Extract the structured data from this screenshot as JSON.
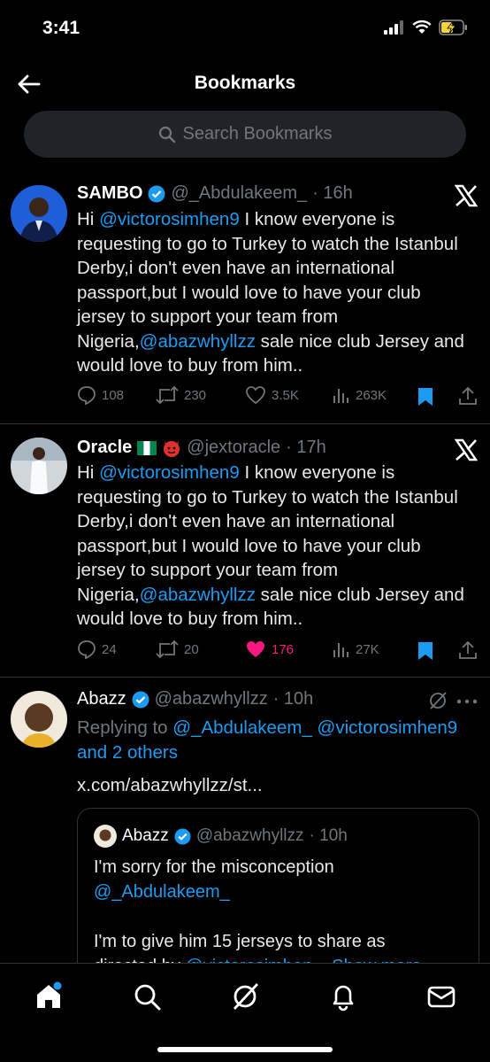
{
  "status": {
    "time": "3:41"
  },
  "header": {
    "title": "Bookmarks"
  },
  "search": {
    "placeholder": "Search Bookmarks"
  },
  "tweets": [
    {
      "name": "SAMBO",
      "handle": "@_Abdulakeem_",
      "time": "· 16h",
      "body": [
        {
          "t": "Hi ",
          "c": "text"
        },
        {
          "t": "@victorosimhen9",
          "c": "link"
        },
        {
          "t": " I know everyone is requesting to go to Turkey to watch the Istanbul Derby,i don't even have an international passport,but I would love to have your club jersey to support your team from Nigeria,",
          "c": "text"
        },
        {
          "t": "@abazwhyllzz",
          "c": "link"
        },
        {
          "t": " sale nice club Jersey and would love to buy from him..",
          "c": "text"
        }
      ],
      "replies": "108",
      "retweets": "230",
      "likes": "3.5K",
      "views": "263K"
    },
    {
      "name": "Oracle",
      "handle": "@jextoracle",
      "time": "· 17h",
      "body": [
        {
          "t": "Hi ",
          "c": "text"
        },
        {
          "t": "@victorosimhen9",
          "c": "link"
        },
        {
          "t": " I know everyone is requesting to go to Turkey to watch the Istanbul Derby,i don't even have an international passport,but I would love to have your club jersey to support your team from Nigeria,",
          "c": "text"
        },
        {
          "t": "@abazwhyllzz",
          "c": "link"
        },
        {
          "t": " sale nice club Jersey and would love to buy from him..",
          "c": "text"
        }
      ],
      "replies": "24",
      "retweets": "20",
      "likes": "176",
      "views": "27K"
    },
    {
      "name": "Abazz",
      "handle": "@abazwhyllzz",
      "time": "· 10h",
      "replying_prefix": "Replying to ",
      "replying_to": "@_Abdulakeem_ @victorosimhen9 and 2 others",
      "link": "x.com/abazwhyllzz/st...",
      "quote": {
        "name": "Abazz",
        "handle": "@abazwhyllzz",
        "time": "· 10h",
        "line1": "I'm sorry for the misconception",
        "line2": "@_Abdulakeem_",
        "line3": "I'm to give him 15 jerseys to share as",
        "line4a": "directed by ",
        "line4b": "@victorosimhen",
        "line4c": "... Show more"
      }
    }
  ],
  "colors": {
    "accent": "#1d9bf0",
    "like": "#f91880",
    "bg": "#000000",
    "muted": "#71767b"
  }
}
